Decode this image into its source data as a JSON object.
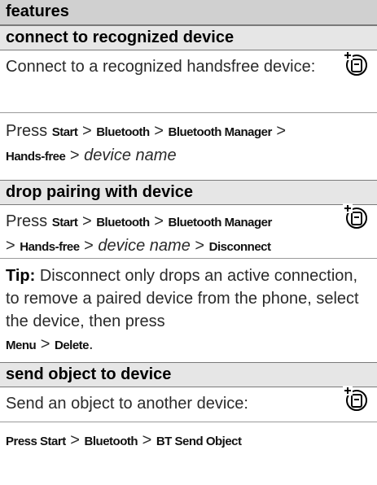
{
  "header": {
    "title": "features"
  },
  "icon": "network-handset-icon",
  "sections": [
    {
      "title": "connect to recognized device",
      "description": "Connect to a recognized handsfree device:",
      "instruction": {
        "press": "Press",
        "start": "Start",
        "bluetooth": "Bluetooth",
        "manager": "Bluetooth Manager",
        "handsfree": "Hands-free",
        "device_name": "device name"
      }
    },
    {
      "title": "drop pairing with device",
      "instruction": {
        "press": "Press",
        "start": "Start",
        "bluetooth": "Bluetooth",
        "manager": "Bluetooth Manager",
        "handsfree": "Hands-free",
        "device_name": "device name",
        "disconnect": "Disconnect"
      },
      "tip": {
        "label": "Tip:",
        "text": " Disconnect only drops an active connection, to remove a paired device from the phone, select the device, then press",
        "menu": "Menu",
        "delete": "Delete"
      }
    },
    {
      "title": "send object to device",
      "description": "Send an object to another device:",
      "instruction": {
        "press_start": "Press Start",
        "bluetooth": "Bluetooth",
        "send_object": "BT Send Object"
      }
    }
  ],
  "separator": ">"
}
